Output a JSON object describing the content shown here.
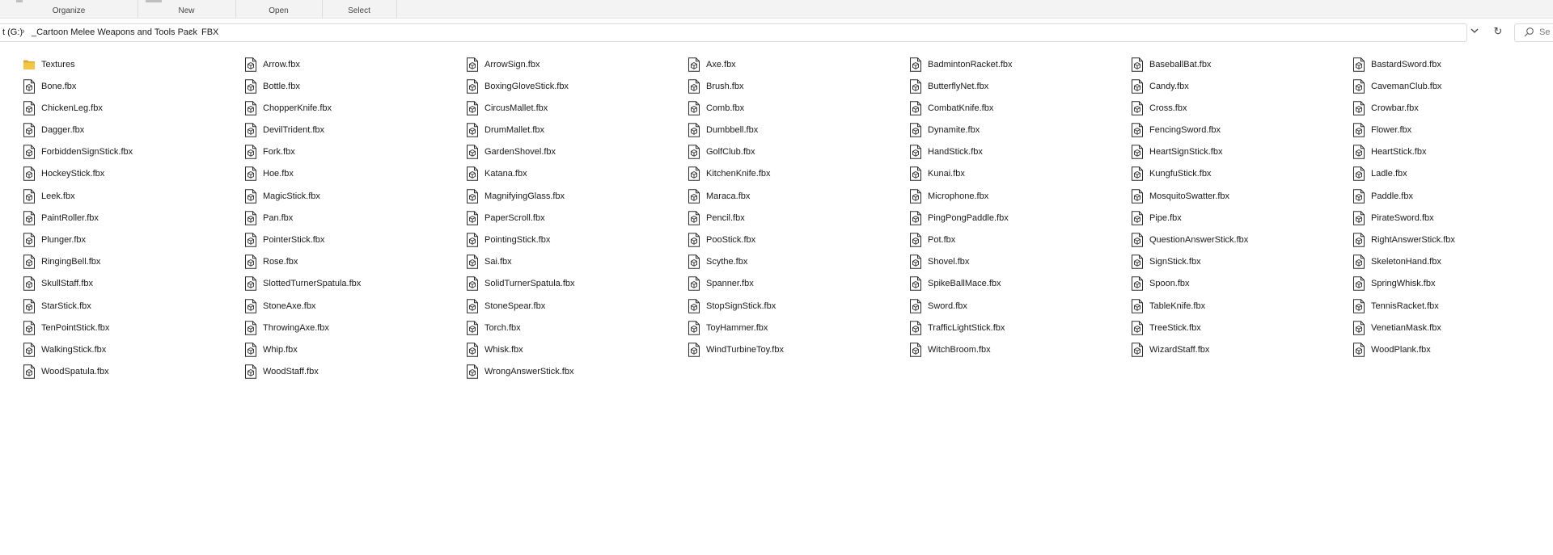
{
  "ribbon": {
    "groups": [
      "Organize",
      "New",
      "Open",
      "Select"
    ]
  },
  "address": {
    "drive": "t (G:)",
    "folder": "_Cartoon Melee Weapons and Tools Pack",
    "subfolder": "FBX",
    "search_placeholder": "Se"
  },
  "items": [
    {
      "name": "Textures",
      "type": "folder"
    },
    {
      "name": "Arrow.fbx",
      "type": "fbx"
    },
    {
      "name": "ArrowSign.fbx",
      "type": "fbx"
    },
    {
      "name": "Axe.fbx",
      "type": "fbx"
    },
    {
      "name": "BadmintonRacket.fbx",
      "type": "fbx"
    },
    {
      "name": "BaseballBat.fbx",
      "type": "fbx"
    },
    {
      "name": "BastardSword.fbx",
      "type": "fbx"
    },
    {
      "name": "Bone.fbx",
      "type": "fbx"
    },
    {
      "name": "Bottle.fbx",
      "type": "fbx"
    },
    {
      "name": "BoxingGloveStick.fbx",
      "type": "fbx"
    },
    {
      "name": "Brush.fbx",
      "type": "fbx"
    },
    {
      "name": "ButterflyNet.fbx",
      "type": "fbx"
    },
    {
      "name": "Candy.fbx",
      "type": "fbx"
    },
    {
      "name": "CavemanClub.fbx",
      "type": "fbx"
    },
    {
      "name": "ChickenLeg.fbx",
      "type": "fbx"
    },
    {
      "name": "ChopperKnife.fbx",
      "type": "fbx"
    },
    {
      "name": "CircusMallet.fbx",
      "type": "fbx"
    },
    {
      "name": "Comb.fbx",
      "type": "fbx"
    },
    {
      "name": "CombatKnife.fbx",
      "type": "fbx"
    },
    {
      "name": "Cross.fbx",
      "type": "fbx"
    },
    {
      "name": "Crowbar.fbx",
      "type": "fbx"
    },
    {
      "name": "Dagger.fbx",
      "type": "fbx"
    },
    {
      "name": "DevilTrident.fbx",
      "type": "fbx"
    },
    {
      "name": "DrumMallet.fbx",
      "type": "fbx"
    },
    {
      "name": "Dumbbell.fbx",
      "type": "fbx"
    },
    {
      "name": "Dynamite.fbx",
      "type": "fbx"
    },
    {
      "name": "FencingSword.fbx",
      "type": "fbx"
    },
    {
      "name": "Flower.fbx",
      "type": "fbx"
    },
    {
      "name": "ForbiddenSignStick.fbx",
      "type": "fbx"
    },
    {
      "name": "Fork.fbx",
      "type": "fbx"
    },
    {
      "name": "GardenShovel.fbx",
      "type": "fbx"
    },
    {
      "name": "GolfClub.fbx",
      "type": "fbx"
    },
    {
      "name": "HandStick.fbx",
      "type": "fbx"
    },
    {
      "name": "HeartSignStick.fbx",
      "type": "fbx"
    },
    {
      "name": "HeartStick.fbx",
      "type": "fbx"
    },
    {
      "name": "HockeyStick.fbx",
      "type": "fbx"
    },
    {
      "name": "Hoe.fbx",
      "type": "fbx"
    },
    {
      "name": "Katana.fbx",
      "type": "fbx"
    },
    {
      "name": "KitchenKnife.fbx",
      "type": "fbx"
    },
    {
      "name": "Kunai.fbx",
      "type": "fbx"
    },
    {
      "name": "KungfuStick.fbx",
      "type": "fbx"
    },
    {
      "name": "Ladle.fbx",
      "type": "fbx"
    },
    {
      "name": "Leek.fbx",
      "type": "fbx"
    },
    {
      "name": "MagicStick.fbx",
      "type": "fbx"
    },
    {
      "name": "MagnifyingGlass.fbx",
      "type": "fbx"
    },
    {
      "name": "Maraca.fbx",
      "type": "fbx"
    },
    {
      "name": "Microphone.fbx",
      "type": "fbx"
    },
    {
      "name": "MosquitoSwatter.fbx",
      "type": "fbx"
    },
    {
      "name": "Paddle.fbx",
      "type": "fbx"
    },
    {
      "name": "PaintRoller.fbx",
      "type": "fbx"
    },
    {
      "name": "Pan.fbx",
      "type": "fbx"
    },
    {
      "name": "PaperScroll.fbx",
      "type": "fbx"
    },
    {
      "name": "Pencil.fbx",
      "type": "fbx"
    },
    {
      "name": "PingPongPaddle.fbx",
      "type": "fbx"
    },
    {
      "name": "Pipe.fbx",
      "type": "fbx"
    },
    {
      "name": "PirateSword.fbx",
      "type": "fbx"
    },
    {
      "name": "Plunger.fbx",
      "type": "fbx"
    },
    {
      "name": "PointerStick.fbx",
      "type": "fbx"
    },
    {
      "name": "PointingStick.fbx",
      "type": "fbx"
    },
    {
      "name": "PooStick.fbx",
      "type": "fbx"
    },
    {
      "name": "Pot.fbx",
      "type": "fbx"
    },
    {
      "name": "QuestionAnswerStick.fbx",
      "type": "fbx"
    },
    {
      "name": "RightAnswerStick.fbx",
      "type": "fbx"
    },
    {
      "name": "RingingBell.fbx",
      "type": "fbx"
    },
    {
      "name": "Rose.fbx",
      "type": "fbx"
    },
    {
      "name": "Sai.fbx",
      "type": "fbx"
    },
    {
      "name": "Scythe.fbx",
      "type": "fbx"
    },
    {
      "name": "Shovel.fbx",
      "type": "fbx"
    },
    {
      "name": "SignStick.fbx",
      "type": "fbx"
    },
    {
      "name": "SkeletonHand.fbx",
      "type": "fbx"
    },
    {
      "name": "SkullStaff.fbx",
      "type": "fbx"
    },
    {
      "name": "SlottedTurnerSpatula.fbx",
      "type": "fbx"
    },
    {
      "name": "SolidTurnerSpatula.fbx",
      "type": "fbx"
    },
    {
      "name": "Spanner.fbx",
      "type": "fbx"
    },
    {
      "name": "SpikeBallMace.fbx",
      "type": "fbx"
    },
    {
      "name": "Spoon.fbx",
      "type": "fbx"
    },
    {
      "name": "SpringWhisk.fbx",
      "type": "fbx"
    },
    {
      "name": "StarStick.fbx",
      "type": "fbx"
    },
    {
      "name": "StoneAxe.fbx",
      "type": "fbx"
    },
    {
      "name": "StoneSpear.fbx",
      "type": "fbx"
    },
    {
      "name": "StopSignStick.fbx",
      "type": "fbx"
    },
    {
      "name": "Sword.fbx",
      "type": "fbx"
    },
    {
      "name": "TableKnife.fbx",
      "type": "fbx"
    },
    {
      "name": "TennisRacket.fbx",
      "type": "fbx"
    },
    {
      "name": "TenPointStick.fbx",
      "type": "fbx"
    },
    {
      "name": "ThrowingAxe.fbx",
      "type": "fbx"
    },
    {
      "name": "Torch.fbx",
      "type": "fbx"
    },
    {
      "name": "ToyHammer.fbx",
      "type": "fbx"
    },
    {
      "name": "TrafficLightStick.fbx",
      "type": "fbx"
    },
    {
      "name": "TreeStick.fbx",
      "type": "fbx"
    },
    {
      "name": "VenetianMask.fbx",
      "type": "fbx"
    },
    {
      "name": "WalkingStick.fbx",
      "type": "fbx"
    },
    {
      "name": "Whip.fbx",
      "type": "fbx"
    },
    {
      "name": "Whisk.fbx",
      "type": "fbx"
    },
    {
      "name": "WindTurbineToy.fbx",
      "type": "fbx"
    },
    {
      "name": "WitchBroom.fbx",
      "type": "fbx"
    },
    {
      "name": "WizardStaff.fbx",
      "type": "fbx"
    },
    {
      "name": "WoodPlank.fbx",
      "type": "fbx"
    },
    {
      "name": "WoodSpatula.fbx",
      "type": "fbx"
    },
    {
      "name": "WoodStaff.fbx",
      "type": "fbx"
    },
    {
      "name": "WrongAnswerStick.fbx",
      "type": "fbx"
    }
  ],
  "colors": {
    "folder": "#f3c545",
    "folder_dark": "#e0a82e",
    "file_stroke": "#2b2b2b"
  }
}
